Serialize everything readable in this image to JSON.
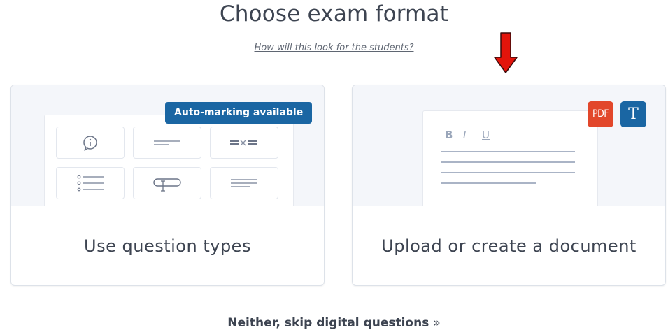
{
  "page": {
    "title": "Choose exam format",
    "help_link": "How will this look for the students?",
    "skip_link": "Neither, skip digital questions",
    "skip_chevron": "»"
  },
  "cards": {
    "question_types": {
      "label": "Use question types",
      "badge": "Auto-marking available",
      "tiles": [
        "info-question-icon",
        "short-answer-icon",
        "matching-icon",
        "list-icon",
        "text-input-icon",
        "paragraph-icon"
      ]
    },
    "document": {
      "label": "Upload or create a document",
      "format_bold": "B",
      "format_italic": "I",
      "format_underline": "U",
      "pdf_icon_label": "PDF",
      "text_icon_label": "T"
    }
  },
  "colors": {
    "accent_blue": "#1a66a3",
    "pdf_red": "#e2472b",
    "annotation_arrow": "#e3140b",
    "text": "#3d4451"
  }
}
